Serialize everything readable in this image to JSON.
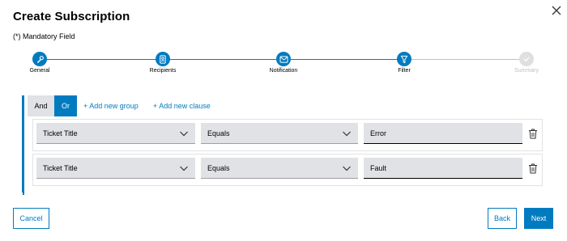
{
  "dialog": {
    "title": "Create Subscription",
    "mandatory_note": "(*) Mandatory Field"
  },
  "stepper": {
    "steps": [
      {
        "label": "General",
        "icon": "wrench-icon",
        "state": "completed"
      },
      {
        "label": "Recipients",
        "icon": "contact-card-icon",
        "state": "completed"
      },
      {
        "label": "Notification",
        "icon": "envelope-icon",
        "state": "completed"
      },
      {
        "label": "Filter",
        "icon": "funnel-icon",
        "state": "active"
      },
      {
        "label": "Summary",
        "icon": "checkmark-icon",
        "state": "inactive"
      }
    ]
  },
  "filter": {
    "operator_and": "And",
    "operator_or": "Or",
    "selected_operator": "Or",
    "add_group_label": "+ Add new group",
    "add_clause_label": "+ Add new clause",
    "rules": [
      {
        "field": "Ticket Title",
        "operator": "Equals",
        "value": "Error"
      },
      {
        "field": "Ticket Title",
        "operator": "Equals",
        "value": "Fault"
      }
    ]
  },
  "footer": {
    "cancel_label": "Cancel",
    "back_label": "Back",
    "next_label": "Next"
  },
  "colors": {
    "accent": "#007bc0",
    "field_background": "#e0e2e5",
    "inactive": "#bfc0c2"
  }
}
